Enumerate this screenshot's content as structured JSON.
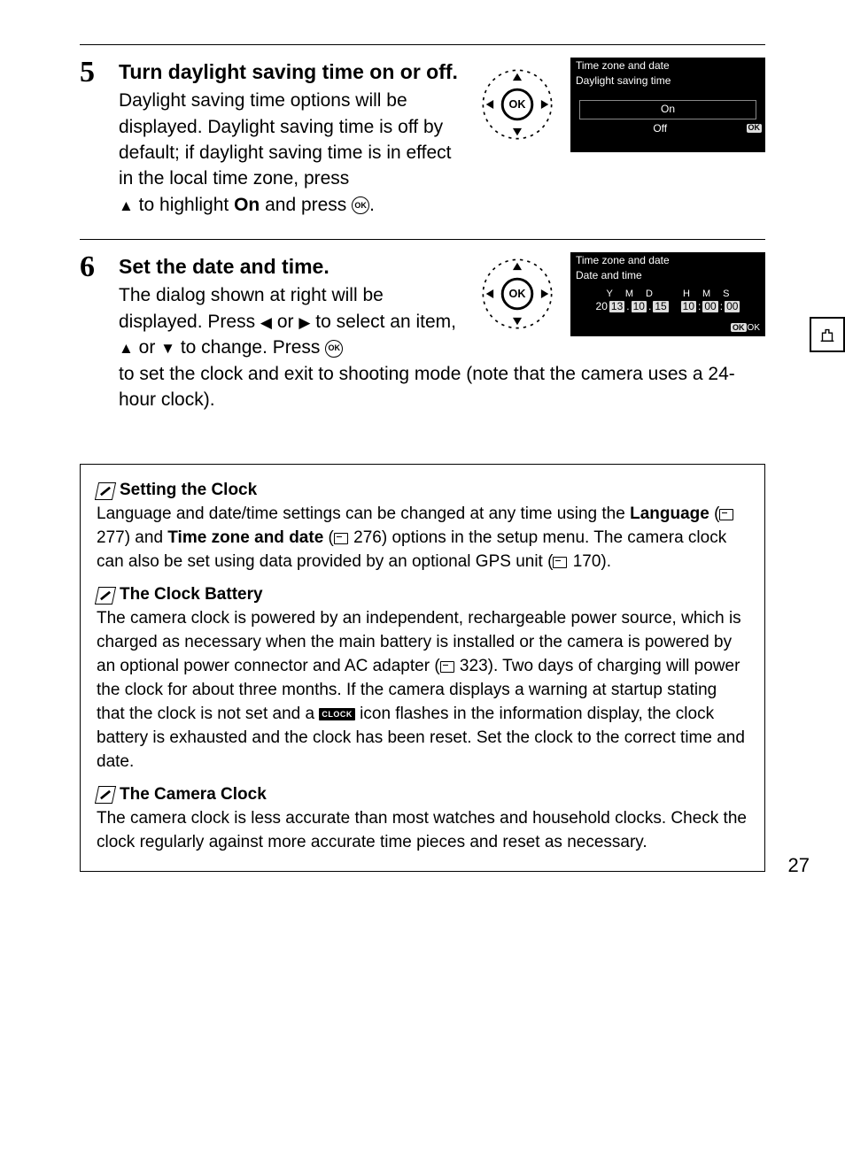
{
  "page_number": "27",
  "step5": {
    "num": "5",
    "title": "Turn daylight saving time on or off.",
    "body_p1": "Daylight saving time options will be displayed.  Daylight saving time is off by default; if daylight saving time is in effect in the local time zone, press ",
    "body_p2": " to highlight ",
    "on_word": "On",
    "body_p3": " and press ",
    "body_p4": ".",
    "lcd": {
      "title": "Time zone and date",
      "subtitle": "Daylight saving time",
      "opt_on": "On",
      "opt_off": "Off",
      "ok": "OK"
    }
  },
  "step6": {
    "num": "6",
    "title": "Set the date and time.",
    "body_a": "The dialog shown at right will be displayed.  Press ",
    "body_b": " or ",
    "body_c": " to select an item, ",
    "body_d": " or ",
    "body_e": " to change.  Press ",
    "body_f": " to set the clock and exit to shooting mode (note that the camera uses a 24-hour clock).",
    "lcd": {
      "title": "Time zone and date",
      "subtitle": "Date and time",
      "hdr": {
        "y": "Y",
        "m": "M",
        "d": "D",
        "h": "H",
        "mi": "M",
        "s": "S"
      },
      "vals": {
        "c": "20",
        "y": "13",
        "m": "10",
        "d": "15",
        "h": "10",
        "mi": "00",
        "s": "00"
      },
      "ok": "OK",
      "ok2": "OK"
    }
  },
  "notes": {
    "n1_title": "Setting the Clock",
    "n1_a": "Language and date/time settings can be changed at any time using the ",
    "n1_lang": "Language",
    "n1_b": " (",
    "n1_p277": " 277) and ",
    "n1_tz": "Time zone and date",
    "n1_c": " (",
    "n1_p276": " 276) options in the setup menu.  The camera clock can also be set using data provided by an optional GPS unit (",
    "n1_p170": " 170).",
    "n2_title": "The Clock Battery",
    "n2_a": "The camera clock is powered by an independent, rechargeable power source, which is charged as necessary when the main battery is installed or the camera is powered by an optional power connector and AC adapter (",
    "n2_p323": " 323).  Two days of charging will power the clock for about three months.  If the camera displays a warning at startup stating that the clock is not set and a ",
    "n2_clock": "CLOCK",
    "n2_b": " icon flashes in the information display, the clock battery is exhausted and the clock has been reset. Set the clock to the correct time and date.",
    "n3_title": "The Camera Clock",
    "n3_body": "The camera clock is less accurate than most watches and household clocks.  Check the clock regularly against more accurate time pieces and reset as necessary."
  }
}
